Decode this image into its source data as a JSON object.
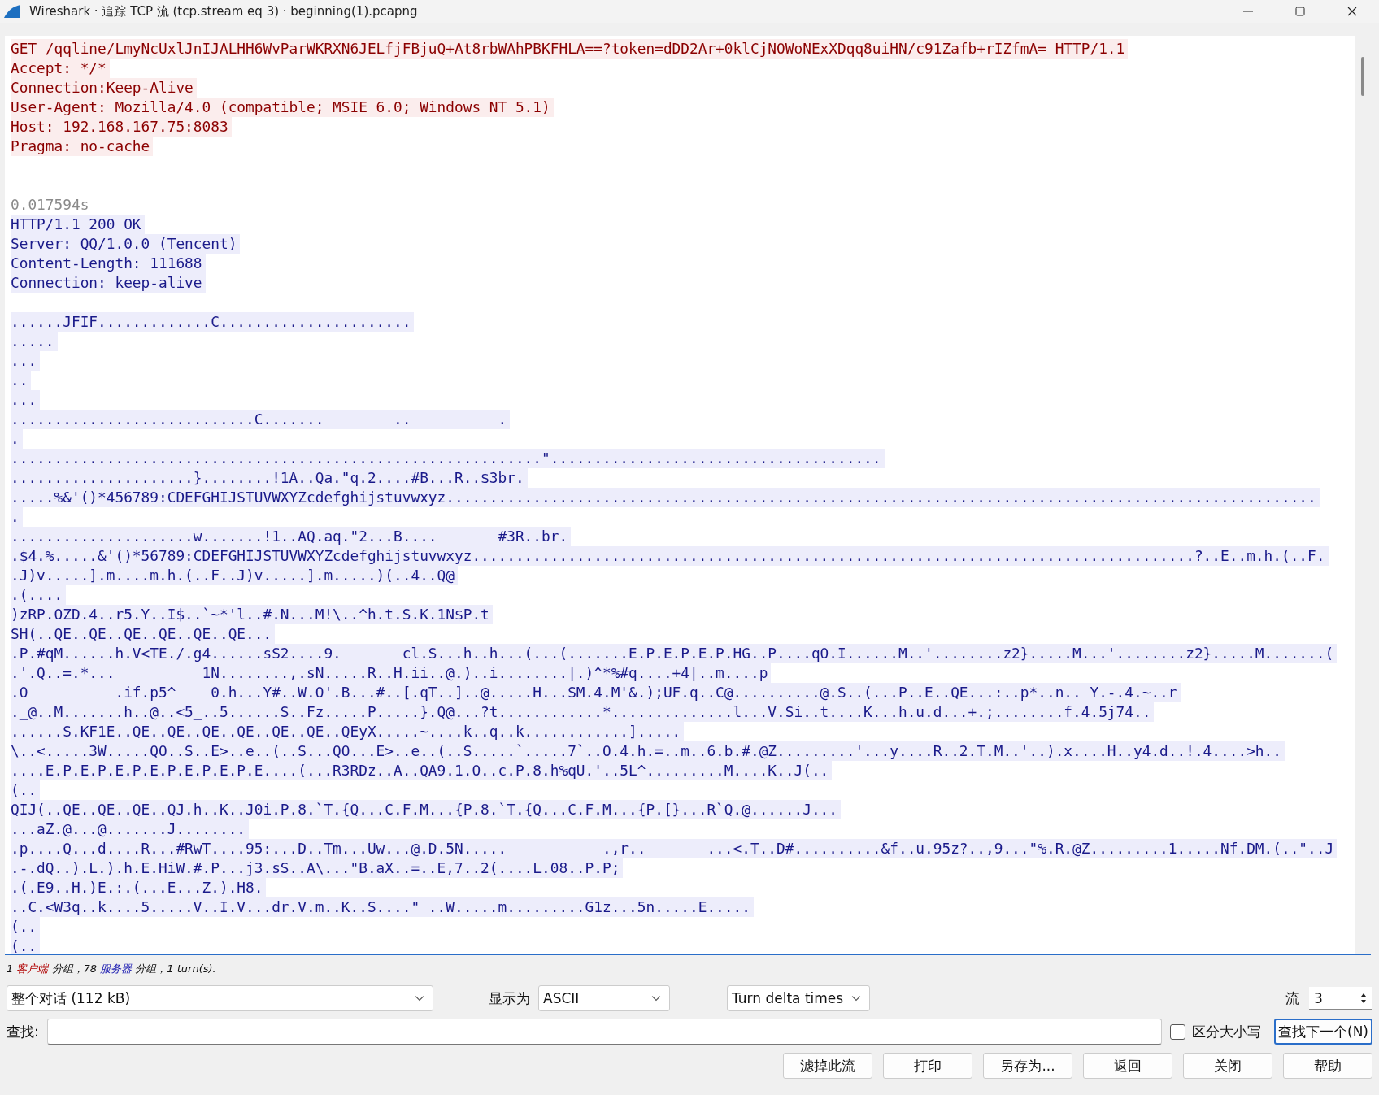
{
  "window": {
    "title": "Wireshark · 追踪 TCP 流 (tcp.stream eq 3) · beginning(1).pcapng"
  },
  "stream": [
    {
      "kind": "client",
      "lines": [
        "GET /qqline/LmyNcUxlJnIJALHH6WvParWKRXN6JELfjFBjuQ+At8rbWAhPBKFHLA==?token=dDD2Ar+0klCjNOWoNExXDqq8uiHN/c91Zafb+rIZfmA= HTTP/1.1",
        "Accept: */*",
        "Connection:Keep-Alive",
        "User-Agent: Mozilla/4.0 (compatible; MSIE 6.0; Windows NT 5.1)",
        "Host: 192.168.167.75:8083",
        "Pragma: no-cache"
      ]
    },
    {
      "kind": "timestamp",
      "lines": [
        "0.017594s"
      ]
    },
    {
      "kind": "server",
      "lines": [
        "HTTP/1.1 200 OK",
        "Server: QQ/1.0.0 (Tencent)",
        "Content-Length: 111688",
        "Connection: keep-alive"
      ]
    },
    {
      "kind": "server",
      "lines": [
        "......JFIF.............C......................",
        ".....",
        "...",
        "..",
        "...",
        "............................C.......        ..          .",
        ".",
        ".............................................................\"......................................",
        ".....................}........!1A..Qa.\"q.2....#B...R..$3br.",
        ".....%&'()*456789:CDEFGHIJSTUVWXYZcdefghijstuvwxyz....................................................................................................",
        ".",
        ".....................w.......!1..AQ.aq.\"2...B....       #3R..br.",
        ".$4.%.....&'()*56789:CDEFGHIJSTUVWXYZcdefghijstuvwxyz...................................................................................?..E..m.h.(..F.",
        ".J)v.....].m....m.h.(..F..J)v.....].m.....)(..4..Q@",
        ".(....",
        ")zRP.OZD.4..r5.Y..I$..`~*'l..#.N...M!\\..^h.t.S.K.1N$P.t",
        "SH(..QE..QE..QE..QE..QE..QE...",
        ".P.#qM......h.V<TE./.g4......sS2....9.       cl.S...h..h...(...(.......E.P.E.P.E.P.HG..P....qO.I......M..'........z2}.....M...'........z2}.....M.......(",
        ".'.Q..=.*...          1N........,.sN.....R..H.ii..@.)..i........|.)^*%#q....+4|..m....p",
        ".O          .if.p5^    0.h...Y#..W.O'.B...#..[.qT..]..@.....H...SM.4.M'&.);UF.q..C@..........@.S..(...P..E..QE...:..p*..n.. Y.-.4.~..r",
        "._@..M.......h..@..<5_..5......S..Fz.....P.....}.Q@...?t............*..............l...V.Si..t....K...h.u.d...+.;........f.4.5j74..",
        "......S.KF1E..QE..QE..QE..QE..QE..QE..QEyX.....~....k..q..k............].....",
        "\\..<.....3W.....QO..S..E>..e..(..S...QO...E>..e..(..S.....`.....7`..O.4.h.=..m..6.b.#.@Z.........'...y....R..2.T.M..'..).x....H..y4.d..!.4....>h..",
        "....E.P.E.P.E.P.E.P.E.P.E.P.E....(...R3RDz..A..QA9.1.O..c.P.8.h%qU.'..5L^.........M....K..J(..",
        "(..",
        "QIJ(..QE..QE..QE..QJ.h..K..J0i.P.8.`T.{Q...C.F.M...{P.8.`T.{Q...C.F.M...{P.[}...R`Q.@......J...",
        "...aZ.@...@.......J........",
        ".p....Q...d....R...#RwT....95:...D..Tm...Uw...@.D.5N.....           .,r..       ...<.T..D#..........&f..u.95z?..,9...\"%.R.@Z.........1.....Nf.DM.(..\"..J",
        ".-.dQ..).L.).h.E.HiW.#.P...j3.sS..A\\...\"B.aX..=..E,7..2(....L.08..P.P;",
        ".(.E9..H.)E.:.(...E...Z.).H8.",
        "..C.<W3q..k....5.....V..I.V...dr.V.m..K..S....\" ..W.....m.........G1z...5n.....E.....",
        "(..",
        "(.."
      ]
    }
  ],
  "status": {
    "parts": [
      {
        "kind": "plain",
        "text": "1 "
      },
      {
        "kind": "client",
        "text": "客户端"
      },
      {
        "kind": "plain",
        "text": " 分组，78 "
      },
      {
        "kind": "server",
        "text": "服务器"
      },
      {
        "kind": "plain",
        "text": " 分组，1 turn(s)."
      }
    ]
  },
  "controls": {
    "conversation": {
      "value": "整个对话 (112 kB)"
    },
    "show_as": {
      "label": "显示为",
      "value": "ASCII"
    },
    "delta": {
      "value": "Turn delta times"
    },
    "stream": {
      "label": "流",
      "value": "3"
    }
  },
  "find": {
    "label": "查找:",
    "case_sensitive": {
      "label": "区分大小写",
      "checked": false
    },
    "next_button": "查找下一个(N)"
  },
  "buttons": [
    "滤掉此流",
    "打印",
    "另存为...",
    "返回",
    "关闭",
    "帮助"
  ]
}
